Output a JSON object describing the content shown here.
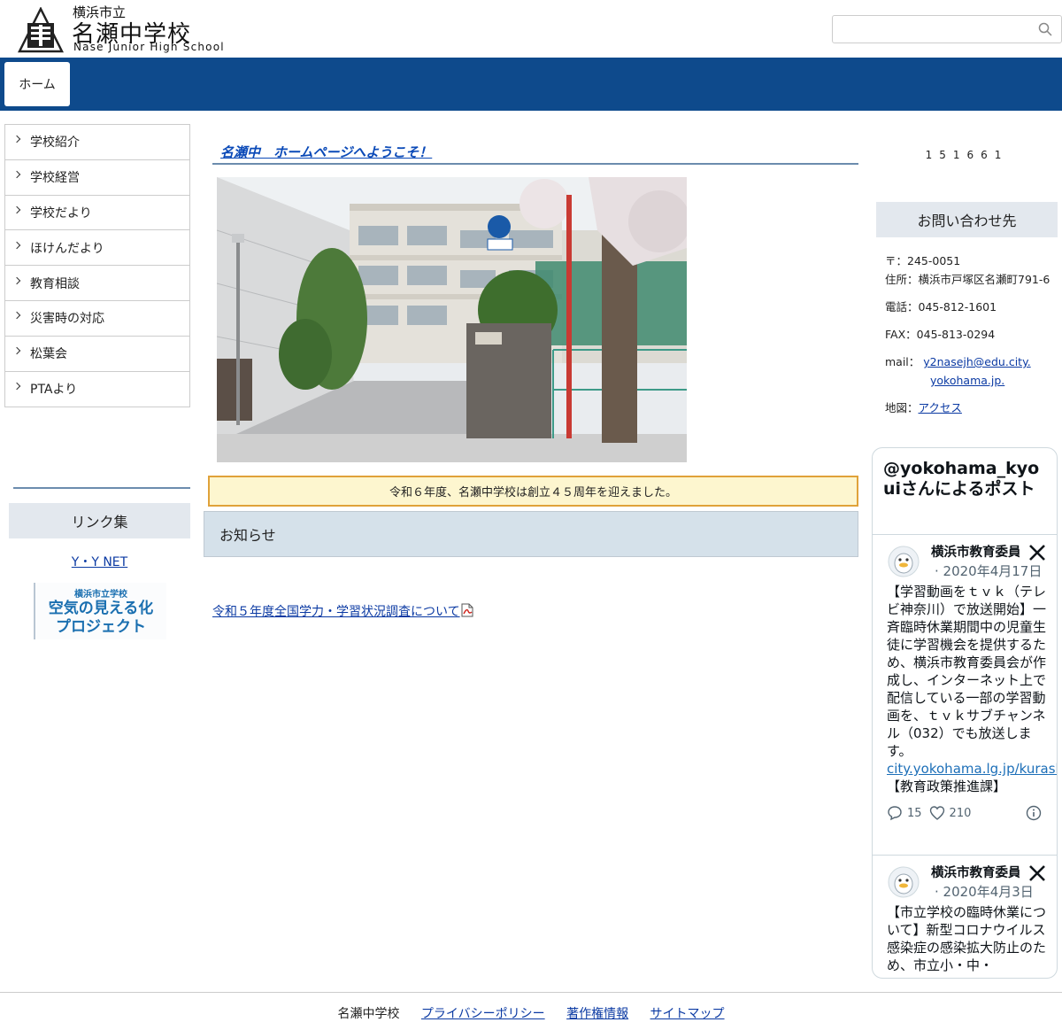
{
  "header": {
    "city": "横浜市立",
    "school_name": "名瀬中学校",
    "school_name_en": "Nase Junior High School",
    "search_placeholder": ""
  },
  "nav": {
    "home": "ホーム"
  },
  "sidebar": {
    "items": [
      {
        "label": "学校紹介"
      },
      {
        "label": "学校経営"
      },
      {
        "label": "学校だより"
      },
      {
        "label": "ほけんだより"
      },
      {
        "label": "教育相談"
      },
      {
        "label": "災害時の対応"
      },
      {
        "label": "松葉会"
      },
      {
        "label": "PTAより"
      }
    ],
    "links_title": "リンク集",
    "link_ynet": "Y・Y NET",
    "air_banner_sub": "横浜市立学校",
    "air_banner_line1": "空気の見える化",
    "air_banner_line2": "プロジェクト"
  },
  "main": {
    "welcome": "名瀬中　ホームページへようこそ！",
    "anniversary": "令和６年度、名瀬中学校は創立４５周年を迎えました。",
    "news_title": "お知らせ",
    "news_item": "令和５年度全国学力・学習状況調査について"
  },
  "right": {
    "counter": "151661",
    "contact_title": "お問い合わせ先",
    "postal": "〒：245-0051",
    "address": "住所：横浜市戸塚区名瀬町791-6",
    "tel": "電話：045-812-1601",
    "fax": "FAX：045-813-0294",
    "mail_label": "mail：",
    "mail_part1": "y2nasejh@edu.city.",
    "mail_part2": "yokohama.jp.",
    "map_label": "地図：",
    "map_link": "アクセス"
  },
  "twitter": {
    "header": "@yokohama_kyouiさんによるポスト",
    "posts": [
      {
        "name": "横浜市教育委員会",
        "date": "· 2020年4月17日",
        "text": "【学習動画をｔｖｋ（テレビ神奈川）で放送開始】一斉臨時休業期間中の児童生徒に学習機会を提供するため、横浜市教育委員会が作成し、インターネット上で配信している一部の学習動画を、ｔｖｋサブチャンネル（032）でも放送します。",
        "link": "city.yokohama.lg.jp/kurashi/kosoda…",
        "tail": "【教育政策推進課】",
        "replies": "15",
        "likes": "210"
      },
      {
        "name": "横浜市教育委員会",
        "date": "· 2020年4月3日",
        "text": "【市立学校の臨時休業について】新型コロナウイルス感染症の感染拡大防止のため、市立小・中・"
      }
    ]
  },
  "footer": {
    "school": "名瀬中学校",
    "privacy": "プライバシーポリシー",
    "copyright": "著作権情報",
    "sitemap": "サイトマップ"
  }
}
